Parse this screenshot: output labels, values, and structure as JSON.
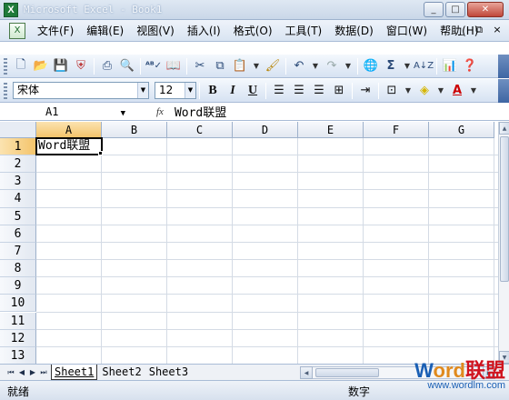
{
  "window": {
    "app_icon": "X",
    "title": "Microsoft Excel - Book1",
    "controls": [
      "_",
      "□",
      "✕"
    ]
  },
  "menu": {
    "items": [
      "文件(F)",
      "编辑(E)",
      "视图(V)",
      "插入(I)",
      "格式(O)",
      "工具(T)",
      "数据(D)",
      "窗口(W)",
      "帮助(H)"
    ],
    "right_controls": [
      "_",
      "⧉",
      "×"
    ]
  },
  "toolbar": {
    "icons": [
      "new-icon",
      "open-icon",
      "save-icon",
      "permission-icon",
      "print-icon",
      "print-preview-icon",
      "spelling-icon",
      "research-icon",
      "cut-icon",
      "copy-icon",
      "paste-icon",
      "format-painter-icon",
      "undo-icon",
      "redo-icon",
      "hyperlink-icon",
      "autosum-icon",
      "sort-ascending-icon",
      "chart-wizard-icon",
      "help-icon"
    ]
  },
  "format_toolbar": {
    "font_name": "宋体",
    "font_size": "12",
    "bold": "B",
    "italic": "I",
    "underline": "U"
  },
  "formula_bar": {
    "name_box": "A1",
    "fx": "fx",
    "content": "Word联盟"
  },
  "sheet": {
    "columns": [
      "A",
      "B",
      "C",
      "D",
      "E",
      "F",
      "G"
    ],
    "rows": [
      "1",
      "2",
      "3",
      "4",
      "5",
      "6",
      "7",
      "8",
      "9",
      "10",
      "11",
      "12",
      "13"
    ],
    "active_cell": "A1",
    "cell_a1": "Word联盟"
  },
  "tabs": {
    "sheets": [
      "Sheet1",
      "Sheet2",
      "Sheet3"
    ],
    "active": "Sheet1"
  },
  "status": {
    "left": "就绪",
    "right": "数字"
  },
  "watermark": {
    "title_w": "W",
    "title_ord": "ord",
    "title_cn": "联盟",
    "url": "www.wordlm.com"
  }
}
